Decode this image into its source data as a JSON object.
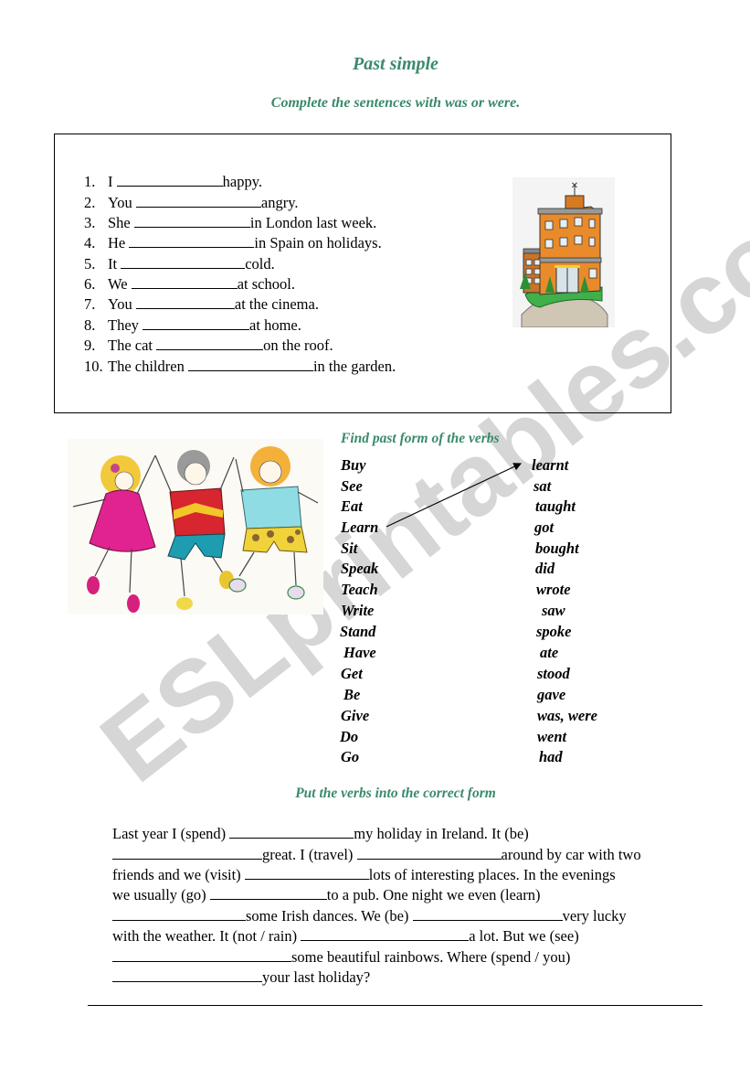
{
  "title": "Past simple",
  "exercise1": {
    "instruction": "Complete the sentences with was or were.",
    "items": [
      {
        "num": "1.",
        "subject": "I",
        "rest": "happy."
      },
      {
        "num": "2.",
        "subject": "You",
        "rest": "angry."
      },
      {
        "num": "3.",
        "subject": "She",
        "rest": "in London last week."
      },
      {
        "num": "4.",
        "subject": "He",
        "rest": "in Spain on holidays."
      },
      {
        "num": "5.",
        "subject": "It",
        "rest": "cold."
      },
      {
        "num": "6.",
        "subject": "We",
        "rest": "at school."
      },
      {
        "num": "7.",
        "subject": "You",
        "rest": "at the cinema."
      },
      {
        "num": "8.",
        "subject": "They",
        "rest": "at home."
      },
      {
        "num": "9.",
        "subject": "The cat",
        "rest": "on the roof."
      },
      {
        "num": "10.",
        "subject": "The children",
        "rest": "in the garden."
      }
    ],
    "image": "school-building-illustration"
  },
  "exercise2": {
    "instruction": "Find past form of the verbs",
    "image": "dancing-children-illustration",
    "base_verbs": [
      "Buy",
      "See",
      "Eat",
      "Learn",
      "Sit",
      "Speak",
      "Teach",
      "Write",
      "Stand",
      "Have",
      "Get",
      "Be",
      "Give",
      "Do",
      "Go"
    ],
    "past_forms": [
      "learnt",
      "sat",
      "taught",
      "got",
      "bought",
      "did",
      "wrote",
      "saw",
      "spoke",
      "ate",
      "stood",
      "gave",
      "was, were",
      "went",
      "had"
    ],
    "example_link": {
      "from": "Learn",
      "to": "learnt"
    }
  },
  "exercise3": {
    "instruction": "Put the verbs into the correct form",
    "lines": [
      [
        {
          "t": "Last year I (spend) "
        },
        {
          "b": 1
        },
        {
          "t": "my holiday in Ireland. It (be)"
        }
      ],
      [
        {
          "b": 1
        },
        {
          "t": "great. I (travel) "
        },
        {
          "b": 1
        },
        {
          "t": "around by car with two"
        }
      ],
      [
        {
          "t": "friends and we (visit) "
        },
        {
          "b": 1
        },
        {
          "t": "lots of interesting places. In the evenings"
        }
      ],
      [
        {
          "t": "we usually (go) "
        },
        {
          "b": 1
        },
        {
          "t": "to a pub. One night we even (learn)"
        }
      ],
      [
        {
          "b": 1
        },
        {
          "t": "some Irish dances. We (be) "
        },
        {
          "b": 1
        },
        {
          "t": "very lucky"
        }
      ],
      [
        {
          "t": "with the weather. It (not / rain) "
        },
        {
          "b": 1
        },
        {
          "t": "a lot. But we (see)"
        }
      ],
      [
        {
          "b": 1
        },
        {
          "t": "some beautiful rainbows. Where (spend / you)"
        }
      ],
      [
        {
          "b": 1
        },
        {
          "t": "your last holiday?"
        }
      ]
    ]
  },
  "watermark": "ESLprintables.com",
  "colors": {
    "heading": "#3a8a6a",
    "watermark": "#c8c8c8"
  }
}
